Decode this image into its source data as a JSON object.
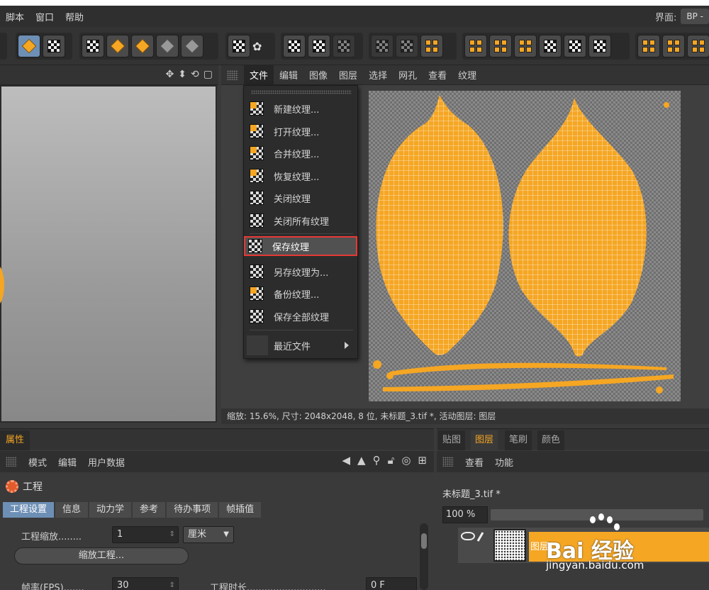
{
  "menubar": {
    "items": [
      "脚本",
      "窗口",
      "帮助"
    ],
    "layout_label": "界面:",
    "layout_value": "BP -"
  },
  "texture_editor": {
    "menu": [
      "文件",
      "编辑",
      "图像",
      "图层",
      "选择",
      "网孔",
      "查看",
      "纹理"
    ],
    "file_menu": {
      "items": [
        "新建纹理...",
        "打开纹理...",
        "合并纹理...",
        "恢复纹理...",
        "关闭纹理",
        "关闭所有纹理",
        "保存纹理",
        "另存纹理为...",
        "备份纹理...",
        "保存全部纹理",
        "最近文件"
      ],
      "highlighted": "保存纹理"
    },
    "status": "缩放: 15.6%, 尺寸: 2048x2048, 8 位, 未标题_3.tif *, 活动图层: 图层"
  },
  "attributes": {
    "tab": "属性",
    "menu": [
      "模式",
      "编辑",
      "用户数据"
    ],
    "title": "工程",
    "tabs": [
      "工程设置",
      "信息",
      "动力学",
      "参考",
      "待办事项",
      "帧插值"
    ],
    "active_tab": "工程设置",
    "scale_label": "工程缩放........",
    "scale_value": "1",
    "scale_unit": "厘米",
    "scale_button": "缩放工程...",
    "fps_label": "帧率(FPS).......",
    "fps_value": "30",
    "duration_label": "工程时长...........................",
    "duration_value": "0 F"
  },
  "layers_panel": {
    "tabs": [
      "贴图",
      "图层",
      "笔刷",
      "颜色"
    ],
    "active_tab": "图层",
    "menu": [
      "查看",
      "功能"
    ],
    "filename": "未标题_3.tif *",
    "zoom": "100 %",
    "layer_name": "图层"
  },
  "watermark": {
    "logo": "Bai 经验",
    "url": "jingyan.baidu.com"
  },
  "colors": {
    "accent": "#f5a623",
    "highlight_border": "#e53935",
    "active_tab": "#6e8fb5"
  }
}
